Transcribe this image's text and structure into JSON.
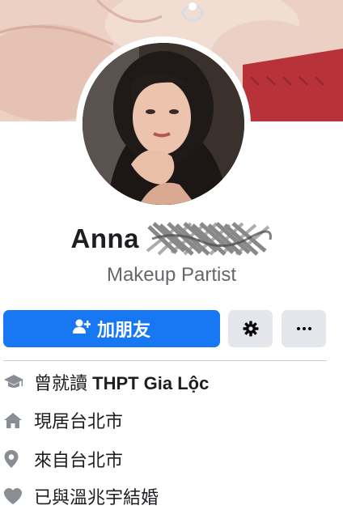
{
  "profile": {
    "name": "Anna",
    "bio": "Makeup Partist"
  },
  "actions": {
    "add_friend_label": "加朋友",
    "add_friend_icon": "person-plus-icon",
    "settings_icon": "gear-icon",
    "more_icon": "ellipsis-icon"
  },
  "intro": [
    {
      "icon": "graduation-cap-icon",
      "prefix": "曾就讀 ",
      "value": "THPT Gia Lộc"
    },
    {
      "icon": "home-icon",
      "prefix": "",
      "value": "現居台北市"
    },
    {
      "icon": "location-pin-icon",
      "prefix": "",
      "value": "來自台北市"
    },
    {
      "icon": "heart-icon",
      "prefix": "",
      "value": "已與溫兆宇結婚"
    }
  ],
  "colors": {
    "primary": "#1877f2",
    "secondary_button": "#e4e6eb",
    "icon_gray": "#8a8d91",
    "subtext": "#65676b"
  }
}
